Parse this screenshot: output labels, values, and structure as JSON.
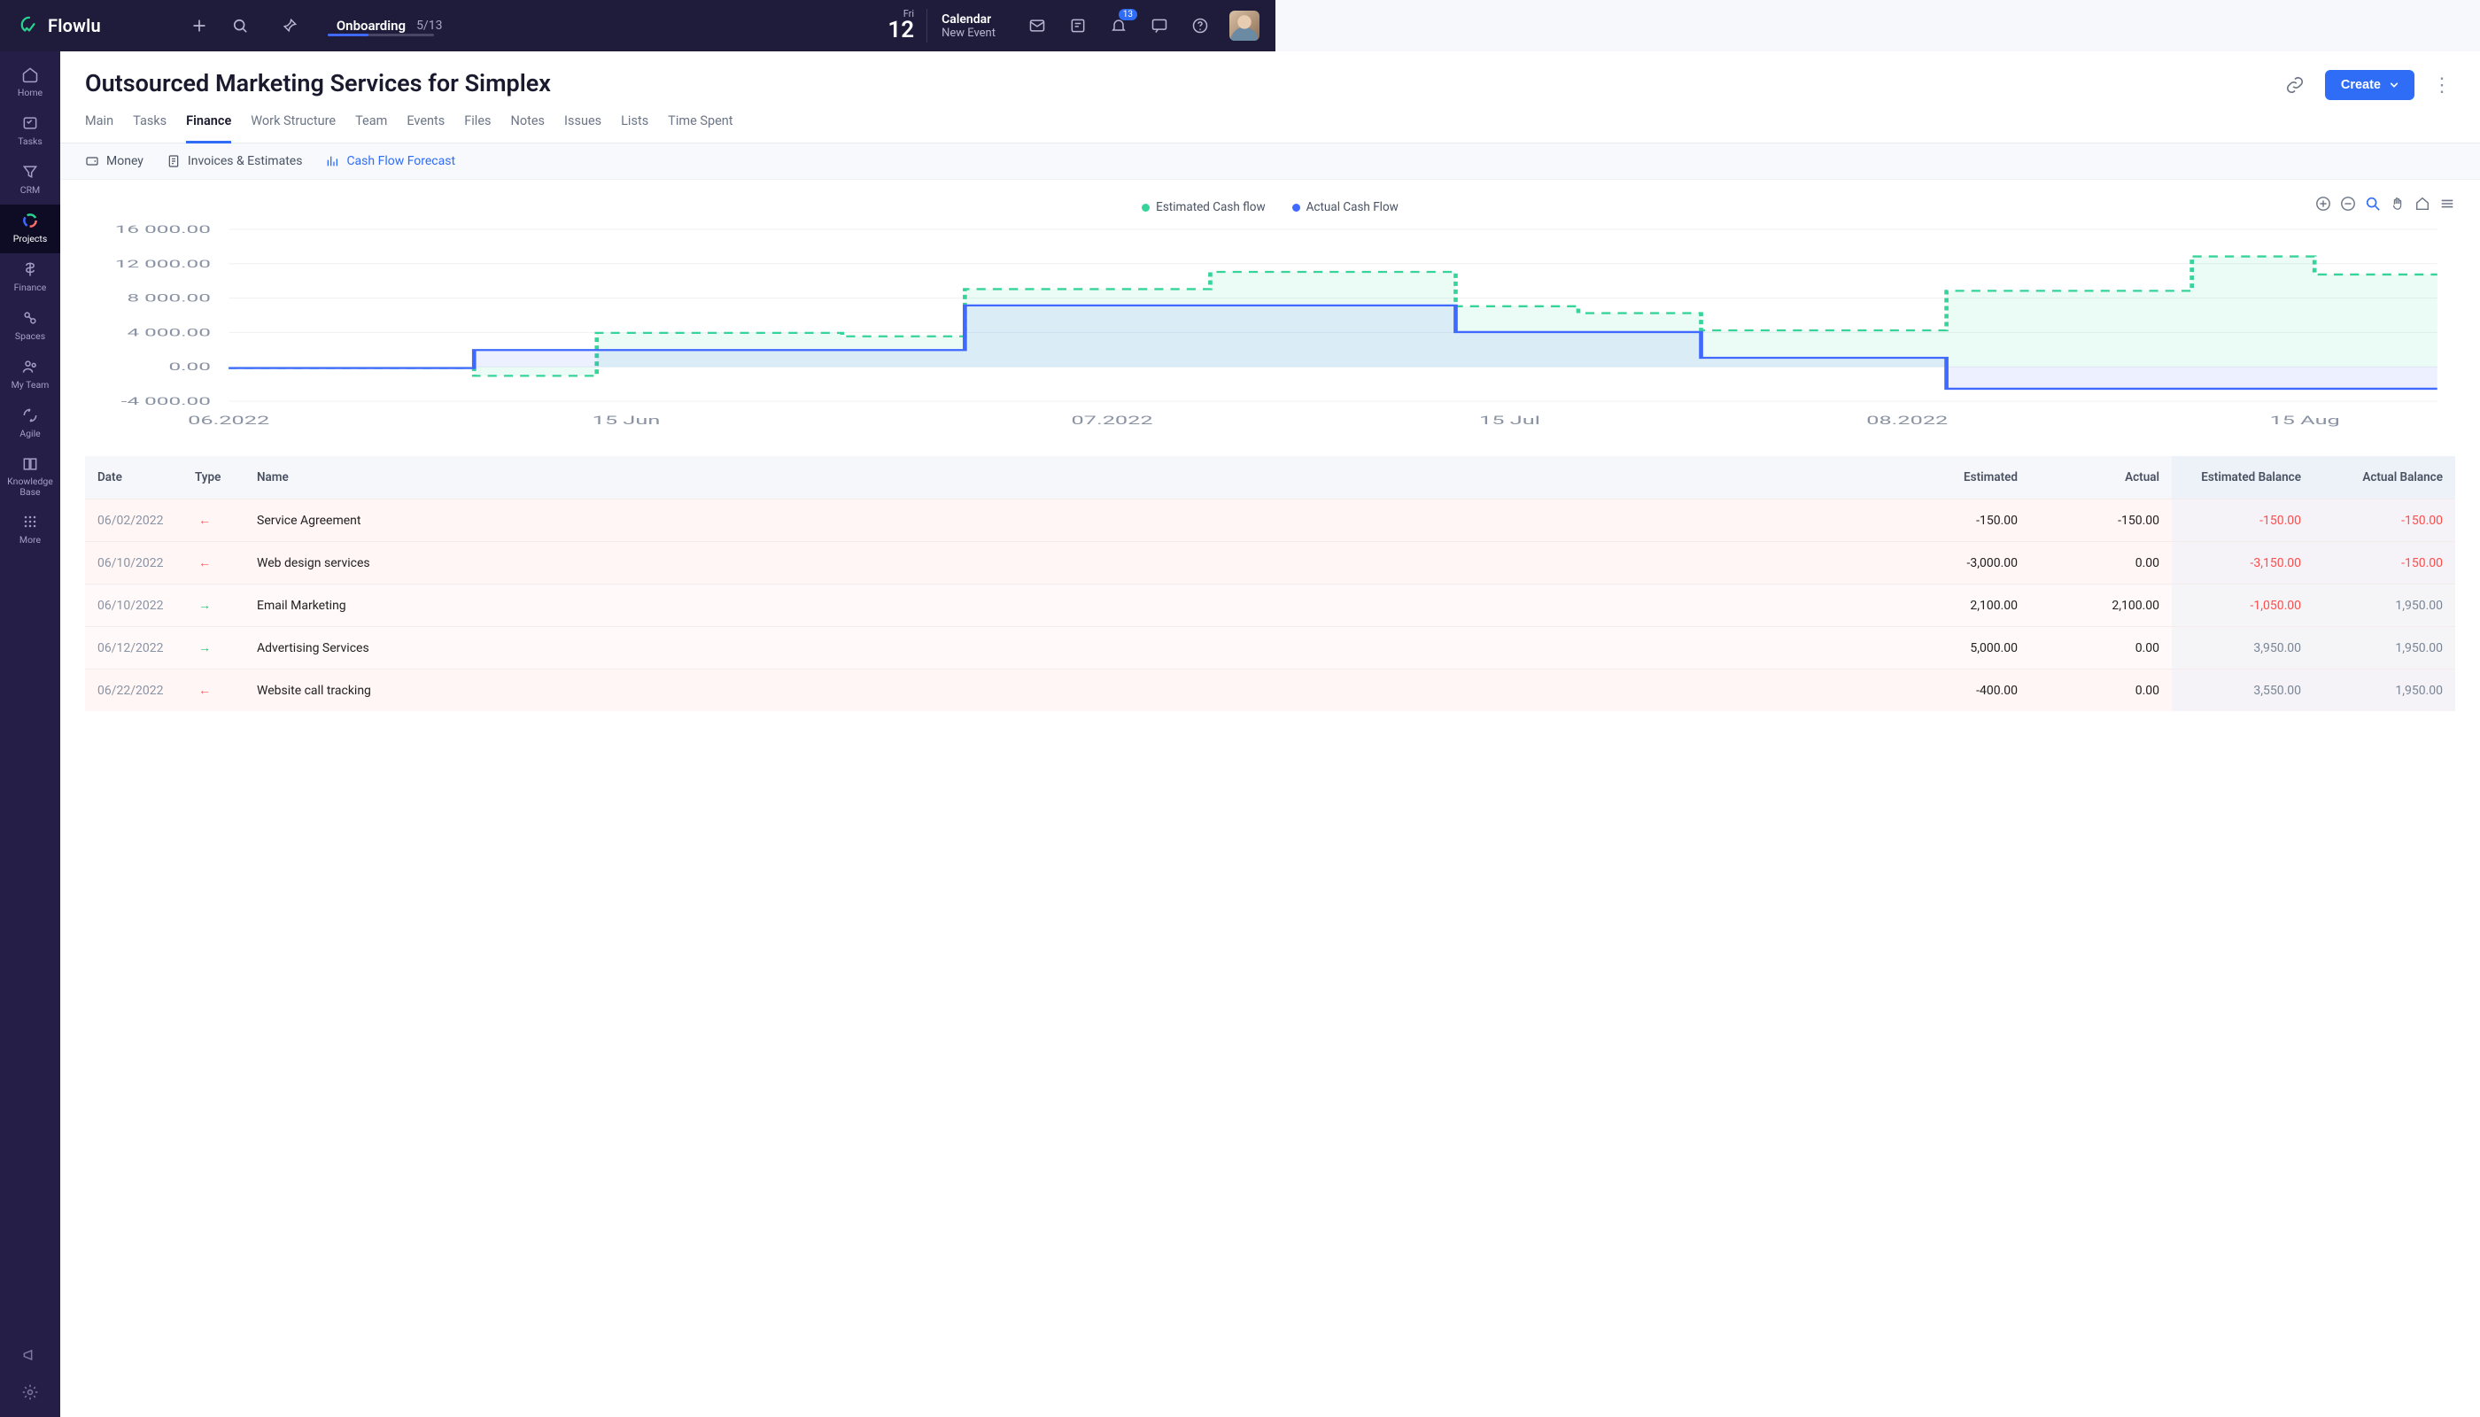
{
  "brand": "Flowlu",
  "topbar": {
    "onboarding_label": "Onboarding",
    "onboarding_count": "5/13",
    "date_dow": "Fri",
    "date_day": "12",
    "calendar_title": "Calendar",
    "calendar_new": "New Event",
    "bell_badge": "13"
  },
  "sidebar": {
    "items": [
      {
        "label": "Home"
      },
      {
        "label": "Tasks"
      },
      {
        "label": "CRM"
      },
      {
        "label": "Projects"
      },
      {
        "label": "Finance"
      },
      {
        "label": "Spaces"
      },
      {
        "label": "My Team"
      },
      {
        "label": "Agile"
      },
      {
        "label": "Knowledge Base"
      },
      {
        "label": "More"
      }
    ]
  },
  "page": {
    "title": "Outsourced Marketing Services for Simplex",
    "create_label": "Create",
    "tabs": [
      "Main",
      "Tasks",
      "Finance",
      "Work Structure",
      "Team",
      "Events",
      "Files",
      "Notes",
      "Issues",
      "Lists",
      "Time Spent"
    ],
    "active_tab": "Finance",
    "subtabs": {
      "money": "Money",
      "invoices": "Invoices & Estimates",
      "cff": "Cash Flow Forecast"
    }
  },
  "chart_data": {
    "type": "line",
    "title": "",
    "xlabel": "",
    "ylabel": "",
    "ylim": [
      -4000,
      16000
    ],
    "y_ticks": [
      -4000,
      0,
      4000,
      8000,
      12000,
      16000
    ],
    "y_tick_labels": [
      "-4 000.00",
      "0.00",
      "4 000.00",
      "8 000.00",
      "12 000.00",
      "16 000.00"
    ],
    "x_tick_labels": [
      "06.2022",
      "15 Jun",
      "07.2022",
      "15 Jul",
      "08.2022",
      "15 Aug"
    ],
    "series": [
      {
        "name": "Estimated Cash flow",
        "color": "#37d49a",
        "values": [
          -150,
          -150,
          -1050,
          3950,
          3950,
          3550,
          9050,
          9050,
          11050,
          11050,
          7050,
          6250,
          4250,
          4250,
          8850,
          8850,
          12850,
          10750,
          10750
        ]
      },
      {
        "name": "Actual Cash Flow",
        "color": "#4069ff",
        "values": [
          -150,
          -150,
          1950,
          1950,
          1950,
          1950,
          7150,
          7150,
          7150,
          7150,
          4050,
          4050,
          1050,
          1050,
          -2550,
          -2550,
          -2550,
          -2550,
          -2550
        ]
      }
    ],
    "x_index": [
      0,
      1,
      2,
      3,
      4,
      5,
      6,
      7,
      8,
      9,
      10,
      11,
      12,
      13,
      14,
      15,
      16,
      17,
      18
    ]
  },
  "legend": {
    "est": "Estimated Cash flow",
    "act": "Actual Cash Flow"
  },
  "table": {
    "headers": {
      "date": "Date",
      "type": "Type",
      "name": "Name",
      "estimated": "Estimated",
      "actual": "Actual",
      "est_balance": "Estimated Balance",
      "act_balance": "Actual Balance"
    },
    "rows": [
      {
        "date": "06/02/2022",
        "dir": "out",
        "name": "Service Agreement",
        "estimated": "-150.00",
        "actual": "-150.00",
        "eb": "-150.00",
        "ab": "-150.00",
        "eb_neg": true,
        "ab_neg": true
      },
      {
        "date": "06/10/2022",
        "dir": "out",
        "name": "Web design services",
        "estimated": "-3,000.00",
        "actual": "0.00",
        "eb": "-3,150.00",
        "ab": "-150.00",
        "eb_neg": true,
        "ab_neg": true
      },
      {
        "date": "06/10/2022",
        "dir": "in",
        "name": "Email Marketing",
        "estimated": "2,100.00",
        "actual": "2,100.00",
        "eb": "-1,050.00",
        "ab": "1,950.00",
        "eb_neg": true,
        "ab_neg": false
      },
      {
        "date": "06/12/2022",
        "dir": "in",
        "name": "Advertising Services",
        "estimated": "5,000.00",
        "actual": "0.00",
        "eb": "3,950.00",
        "ab": "1,950.00",
        "eb_neg": false,
        "ab_neg": false
      },
      {
        "date": "06/22/2022",
        "dir": "out",
        "name": "Website call tracking",
        "estimated": "-400.00",
        "actual": "0.00",
        "eb": "3,550.00",
        "ab": "1,950.00",
        "eb_neg": false,
        "ab_neg": false
      }
    ]
  }
}
